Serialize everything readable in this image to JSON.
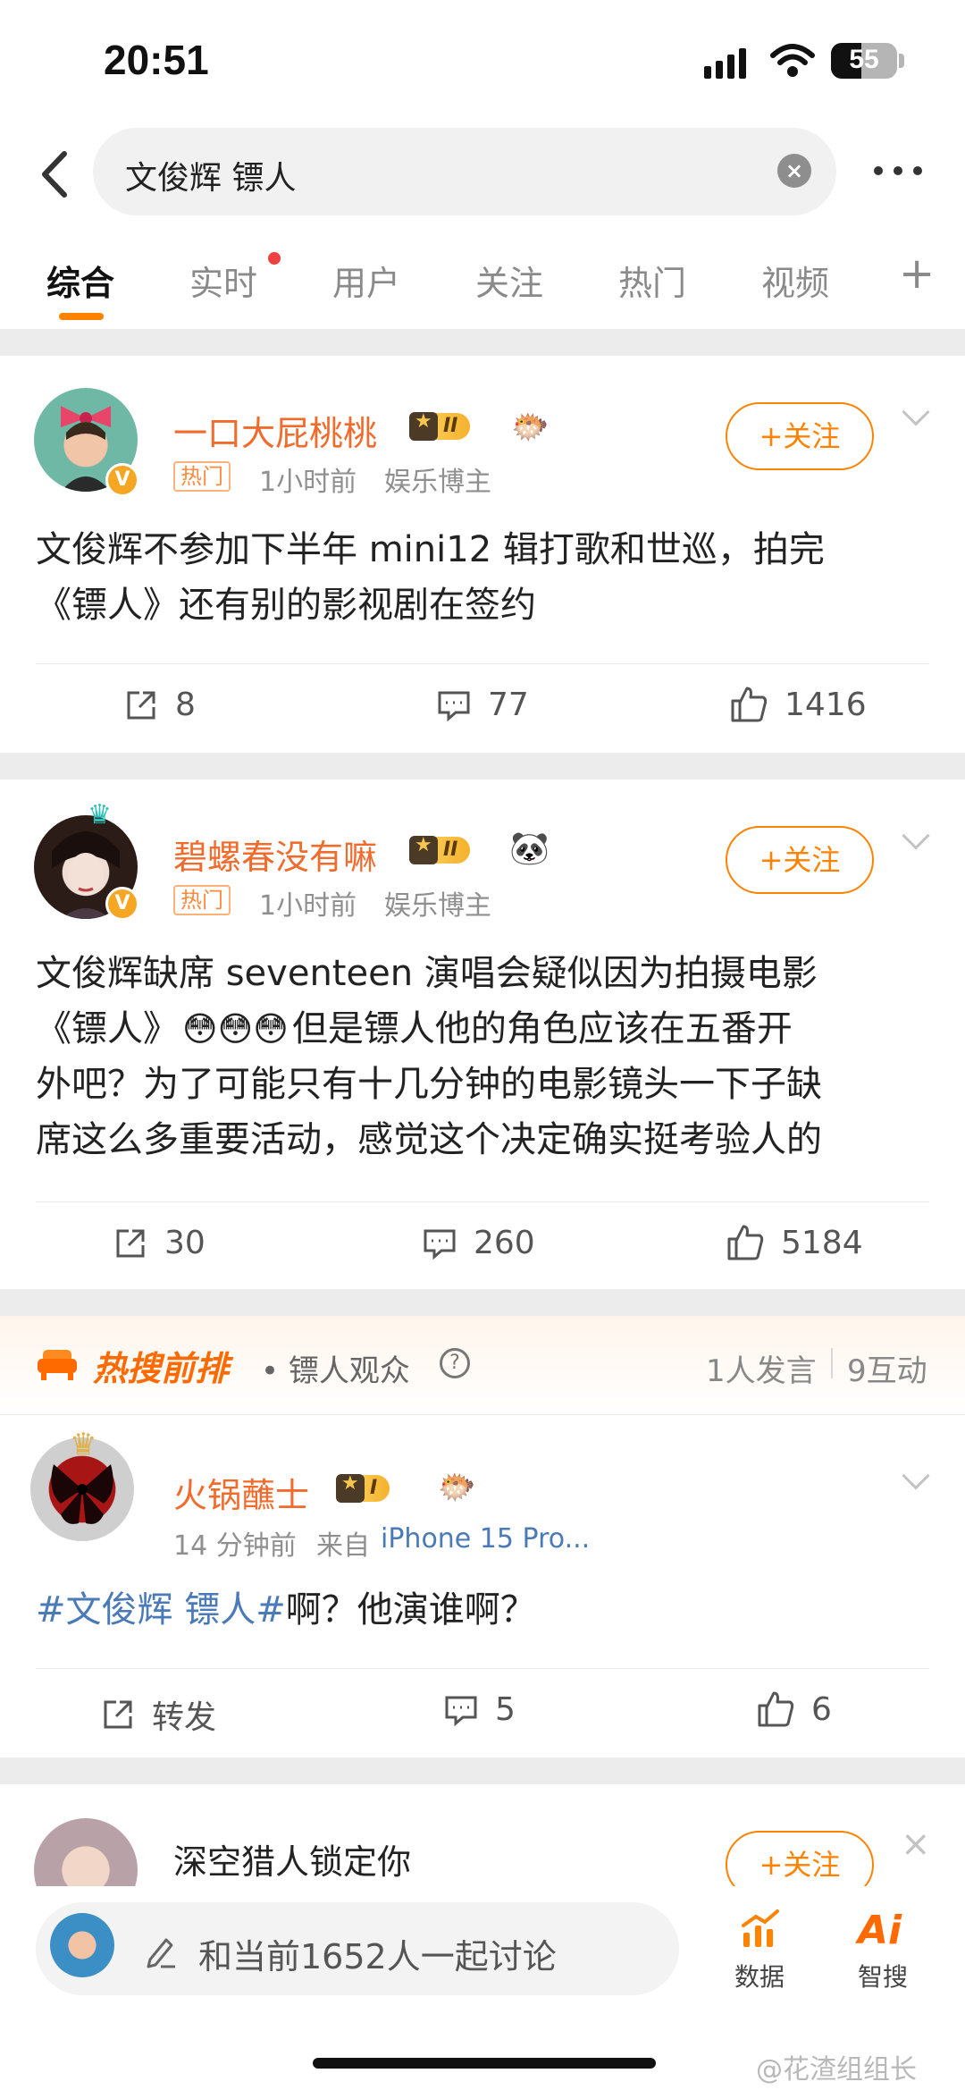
{
  "status": {
    "time": "20:51",
    "battery": "55"
  },
  "search": {
    "query": "文俊辉 镖人"
  },
  "tabs": [
    "综合",
    "实时",
    "用户",
    "关注",
    "热门",
    "视频"
  ],
  "posts": [
    {
      "username": "一口大屁桃桃",
      "level": "II",
      "badge": "热门",
      "time": "1小时前",
      "role": "娱乐博主",
      "follow": "+关注",
      "text": "文俊辉不参加下半年 mini12 辑打歌和世巡，拍完《镖人》还有别的影视剧在签约",
      "line1": "文俊辉不参加下半年 mini12 辑打歌和世巡，拍完",
      "line2": "《镖人》还有别的影视剧在签约",
      "reposts": "8",
      "comments": "77",
      "likes": "1416"
    },
    {
      "username": "碧螺春没有嘛",
      "level": "II",
      "badge": "热门",
      "time": "1小时前",
      "role": "娱乐博主",
      "follow": "+关注",
      "line1": "文俊辉缺席 seventeen 演唱会疑似因为拍摄电影",
      "line2a": "《镖人》",
      "emoji": "😳😳😳",
      "line2b": "但是镖人他的角色应该在五番开",
      "line3": "外吧？为了可能只有十几分钟的电影镜头一下子缺",
      "line4": "席这么多重要活动，感觉这个决定确实挺考验人的",
      "reposts": "30",
      "comments": "260",
      "likes": "5184"
    },
    {
      "username": "火锅蘸士",
      "level": "I",
      "time": "14 分钟前",
      "source_prefix": "来自",
      "source": "iPhone 15 Pro...",
      "hashtag": "#文俊辉 镖人#",
      "text": "啊？他演谁啊？",
      "reposts": "转发",
      "comments": "5",
      "likes": "6"
    },
    {
      "username": "深空猎人锁定你",
      "follow": "+关注"
    }
  ],
  "hot_strip": {
    "title": "热搜前排",
    "topic": "• 镖人观众",
    "stats1": "1人发言",
    "stats2": "9互动"
  },
  "bottom": {
    "discuss": "和当前1652人一起讨论",
    "data": "数据",
    "smart": "智搜",
    "watermark": "@花渣组组长"
  }
}
